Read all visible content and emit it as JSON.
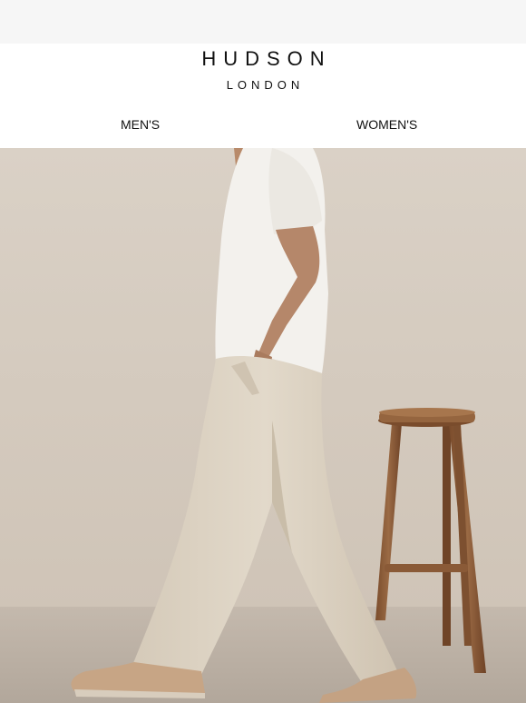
{
  "brand": {
    "name": "HUDSON",
    "sub": "LONDON"
  },
  "nav": {
    "items": [
      {
        "label": "MEN'S"
      },
      {
        "label": "WOMEN'S"
      }
    ]
  },
  "hero": {
    "image_description": "Man in white t-shirt and beige linen trousers walking beside a wooden stool",
    "colors": {
      "wall": "#d9cfc4",
      "floor": "#bdb3a8",
      "tshirt": "#f4f2ee",
      "trousers": "#dcd2c2",
      "skin": "#b88a6a",
      "wood": "#8a5a37",
      "shoes": "#c9a888"
    }
  }
}
